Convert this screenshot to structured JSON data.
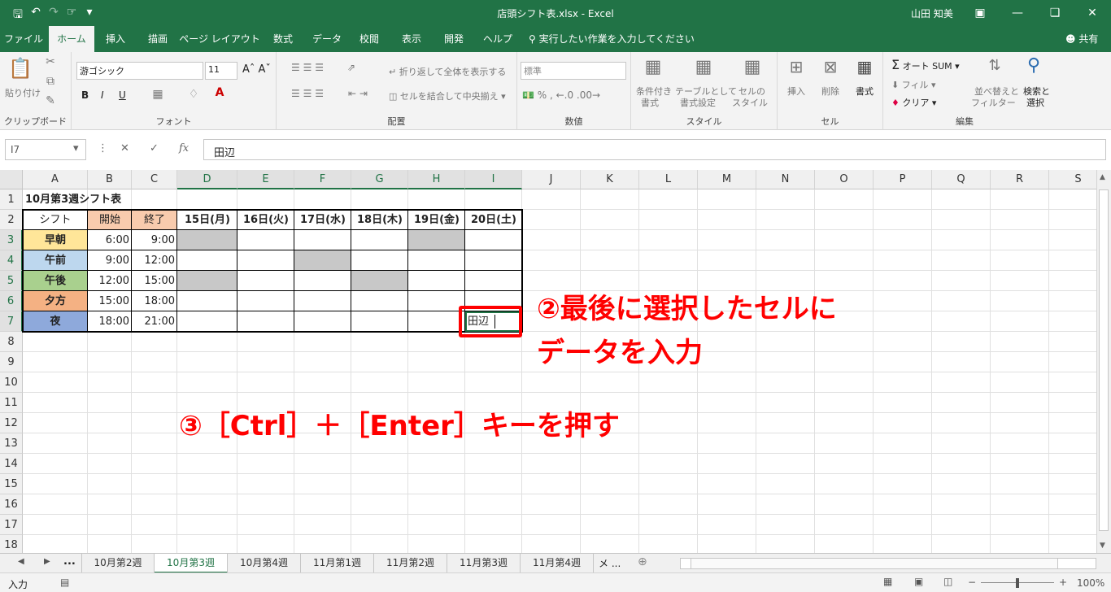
{
  "app": {
    "title": "店頭シフト表.xlsx  -  Excel",
    "user": "山田 知美",
    "accent": "#217346"
  },
  "quick_access": [
    "save-icon",
    "undo-icon",
    "redo-icon",
    "touch-mode-icon",
    "customize-icon"
  ],
  "tabs": [
    "ファイル",
    "ホーム",
    "挿入",
    "描画",
    "ページ レイアウト",
    "数式",
    "データ",
    "校閲",
    "表示",
    "開発",
    "ヘルプ"
  ],
  "active_tab": "ホーム",
  "tell_me": "実行したい作業を入力してください",
  "share": "共有",
  "ribbon": {
    "clipboard": {
      "label": "クリップボード",
      "paste": "貼り付け"
    },
    "font": {
      "label": "フォント",
      "name": "游ゴシック",
      "size": "11",
      "bold": "B",
      "italic": "I",
      "underline": "U"
    },
    "alignment": {
      "label": "配置",
      "wrap": "折り返して全体を表示する",
      "merge": "セルを結合して中央揃え"
    },
    "number": {
      "label": "数値",
      "format": "標準"
    },
    "styles": {
      "label": "スタイル",
      "conditional": "条件付き",
      "conditional2": "書式",
      "table": "テーブルとして",
      "table2": "書式設定",
      "cell": "セルの",
      "cell2": "スタイル"
    },
    "cells": {
      "label": "セル",
      "insert": "挿入",
      "delete": "削除",
      "format": "書式"
    },
    "editing": {
      "label": "編集",
      "autosum": "オート SUM",
      "fill": "フィル",
      "clear": "クリア",
      "sort": "並べ替えと",
      "sort2": "フィルター",
      "find": "検索と",
      "find2": "選択"
    }
  },
  "formula_bar": {
    "name_box": "I7",
    "value": "田辺",
    "fx": "fx"
  },
  "columns": [
    "A",
    "B",
    "C",
    "D",
    "E",
    "F",
    "G",
    "H",
    "I",
    "J",
    "K",
    "L",
    "M",
    "N",
    "O",
    "P",
    "Q",
    "R",
    "S"
  ],
  "rows": [
    "1",
    "2",
    "3",
    "4",
    "5",
    "6",
    "7",
    "8",
    "9",
    "10",
    "11",
    "12",
    "13",
    "14",
    "15",
    "16",
    "17",
    "18"
  ],
  "sheet": {
    "title": "10月第3週シフト表",
    "headers": [
      "シフト",
      "開始",
      "終了",
      "15日(月)",
      "16日(火)",
      "17日(水)",
      "18日(木)",
      "19日(金)",
      "20日(土)"
    ],
    "shifts": [
      {
        "name": "早朝",
        "start": "6:00",
        "end": "9:00",
        "color": "#ffe699"
      },
      {
        "name": "午前",
        "start": "9:00",
        "end": "12:00",
        "color": "#bdd7ee"
      },
      {
        "name": "午後",
        "start": "12:00",
        "end": "15:00",
        "color": "#a9d08e"
      },
      {
        "name": "夕方",
        "start": "15:00",
        "end": "18:00",
        "color": "#f4b183"
      },
      {
        "name": "夜",
        "start": "18:00",
        "end": "21:00",
        "color": "#8ea9db"
      }
    ],
    "header_fill": "#f8cbad",
    "gray_fill": "#c8c8c8",
    "entered_value": "田辺"
  },
  "annotations": {
    "note2_line1": "②最後に選択したセルに",
    "note2_line2": "データを入力",
    "note3": "③［Ctrl］＋［Enter］キーを押す",
    "color": "#ff0000"
  },
  "sheet_tabs": [
    "10月第2週",
    "10月第3週",
    "10月第4週",
    "11月第1週",
    "11月第2週",
    "11月第3週",
    "11月第4週"
  ],
  "active_sheet": "10月第3週",
  "sheet_nav": {
    "more": "...",
    "more_right": "メ ..."
  },
  "status": {
    "mode": "入力",
    "zoom": "100%"
  }
}
